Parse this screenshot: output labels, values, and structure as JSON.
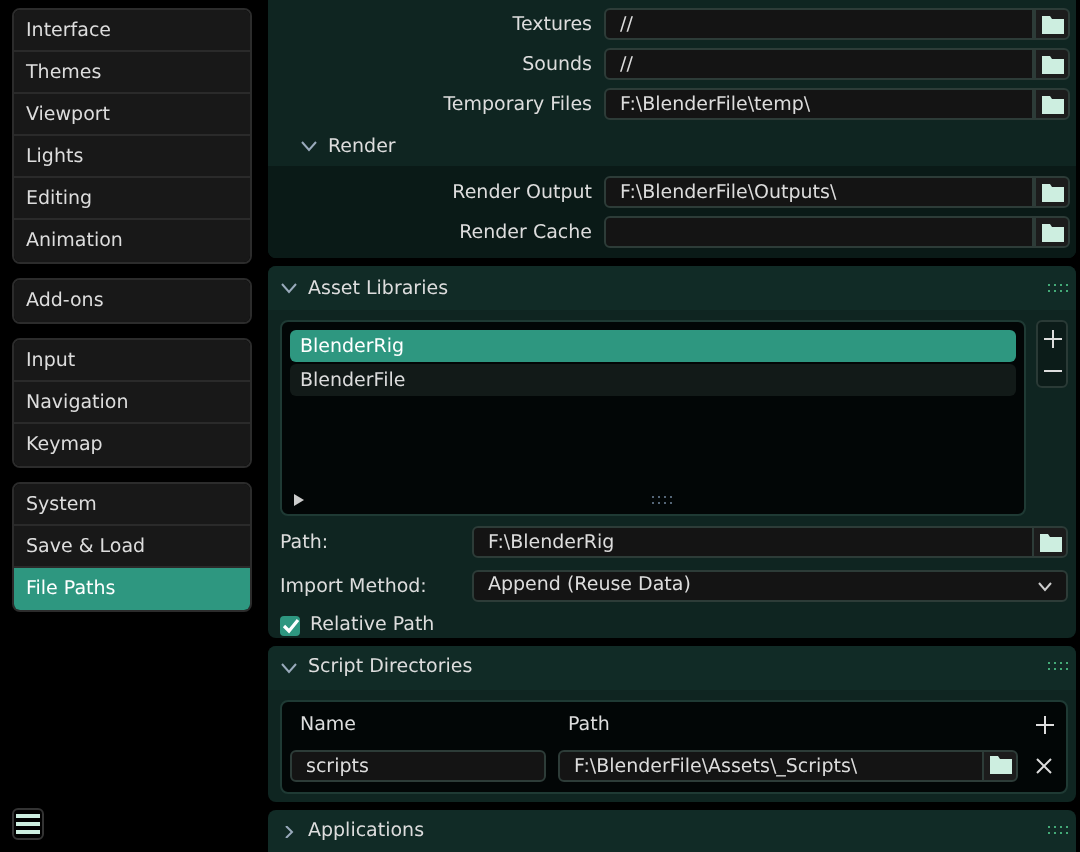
{
  "sidebar": {
    "groups": [
      {
        "items": [
          {
            "label": "Interface",
            "selected": false
          },
          {
            "label": "Themes",
            "selected": false
          },
          {
            "label": "Viewport",
            "selected": false
          },
          {
            "label": "Lights",
            "selected": false
          },
          {
            "label": "Editing",
            "selected": false
          },
          {
            "label": "Animation",
            "selected": false
          }
        ]
      },
      {
        "items": [
          {
            "label": "Add-ons",
            "selected": false
          }
        ]
      },
      {
        "items": [
          {
            "label": "Input",
            "selected": false
          },
          {
            "label": "Navigation",
            "selected": false
          },
          {
            "label": "Keymap",
            "selected": false
          }
        ]
      },
      {
        "items": [
          {
            "label": "System",
            "selected": false
          },
          {
            "label": "Save & Load",
            "selected": false
          },
          {
            "label": "File Paths",
            "selected": true
          }
        ]
      }
    ]
  },
  "file_paths": {
    "rows": [
      {
        "label": "Textures",
        "value": "//"
      },
      {
        "label": "Sounds",
        "value": "//"
      },
      {
        "label": "Temporary Files",
        "value": "F:\\BlenderFile\\temp\\"
      }
    ],
    "render": {
      "title": "Render",
      "expanded": true,
      "rows": [
        {
          "label": "Render Output",
          "value": "F:\\BlenderFile\\Outputs\\"
        },
        {
          "label": "Render Cache",
          "value": ""
        }
      ]
    }
  },
  "asset_libraries": {
    "title": "Asset Libraries",
    "expanded": true,
    "items": [
      {
        "name": "BlenderRig",
        "selected": true
      },
      {
        "name": "BlenderFile",
        "selected": false
      }
    ],
    "path_label": "Path:",
    "path": "F:\\BlenderRig",
    "import_label": "Import Method:",
    "import_method": "Append (Reuse Data)",
    "relative_path": {
      "label": "Relative Path",
      "checked": true
    }
  },
  "script_directories": {
    "title": "Script Directories",
    "expanded": true,
    "columns": [
      "Name",
      "Path"
    ],
    "rows": [
      {
        "name": "scripts",
        "path": "F:\\BlenderFile\\Assets\\_Scripts\\"
      }
    ]
  },
  "applications": {
    "title": "Applications",
    "expanded": false
  }
}
